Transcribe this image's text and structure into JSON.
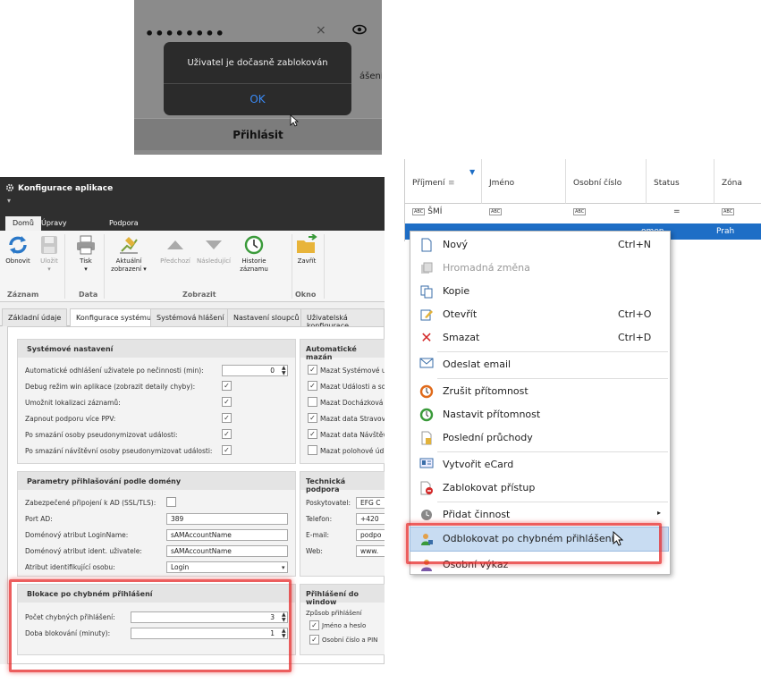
{
  "login": {
    "password_dots": "••••••••",
    "clear_glyph": "×",
    "behind_text": "ášení",
    "login_button": "Přihlásit",
    "alert_message": "Uživatel je dočasně zablokován",
    "alert_ok": "OK"
  },
  "config": {
    "window_title": "Konfigurace aplikace",
    "ribbon_tabs": [
      "Domů",
      "Úpravy",
      "Podpora"
    ],
    "buttons": {
      "refresh": "Obnovit",
      "save": "Uložit",
      "print": "Tisk",
      "current_view": "Aktuální zobrazení ▾",
      "previous": "Předchozí",
      "next": "Následující",
      "history": "Historie záznamu",
      "close": "Zavřít"
    },
    "groups": {
      "record": "Záznam",
      "data": "Data",
      "display": "Zobrazit",
      "window": "Okno"
    },
    "page_tabs": [
      "Základní údaje",
      "Konfigurace systému",
      "Systémová hlášení",
      "Nastavení sloupců",
      "Uživatelská konfigurace"
    ],
    "system_settings": {
      "title": "Systémové nastavení",
      "rows": [
        {
          "label": "Automatické odhlášení uživatele po nečinnosti (min):",
          "value": "0"
        },
        {
          "label": "Debug režim win aplikace (zobrazit detaily chyby):",
          "value": "✓"
        },
        {
          "label": "Umožnit lokalizaci záznamů:",
          "value": "✓"
        },
        {
          "label": "Zapnout podporu více PPV:",
          "value": "✓"
        },
        {
          "label": "Po smazání osoby pseudonymizovat události:",
          "value": "✓"
        },
        {
          "label": "Po smazání návštěvní osoby pseudonymizovat události:",
          "value": "✓"
        }
      ]
    },
    "auto_delete": {
      "title": "Automatické mazán",
      "rows": [
        {
          "label": "Mazat Systémové u",
          "value": "✓"
        },
        {
          "label": "Mazat Události a so",
          "value": "✓"
        },
        {
          "label": "Mazat Docházková",
          "value": ""
        },
        {
          "label": "Mazat data Stravov",
          "value": "✓"
        },
        {
          "label": "Mazat data Návštěv",
          "value": "✓"
        },
        {
          "label": "Mazat polohové úd",
          "value": ""
        }
      ]
    },
    "domain_login": {
      "title": "Parametry přihlašování podle domény",
      "rows": [
        {
          "label": "Zabezpečené připojení k AD (SSL/TLS):",
          "value": ""
        },
        {
          "label": "Port AD:",
          "value": "389"
        },
        {
          "label": "Doménový atribut LoginName:",
          "value": "sAMAccountName"
        },
        {
          "label": "Doménový atribut ident. uživatele:",
          "value": "sAMAccountName"
        },
        {
          "label": "Atribut identifikující osobu:",
          "value": "Login"
        }
      ]
    },
    "tech_support": {
      "title": "Technická podpora",
      "rows": [
        {
          "label": "Poskytovatel:",
          "value": "EFG C"
        },
        {
          "label": "Telefon:",
          "value": "+420"
        },
        {
          "label": "E-mail:",
          "value": "podpo"
        },
        {
          "label": "Web:",
          "value": "www."
        }
      ]
    },
    "lockout": {
      "title": "Blokace po chybném přihlášení",
      "rows": [
        {
          "label": "Počet chybných přihlášení:",
          "value": "3"
        },
        {
          "label": "Doba blokování (minuty):",
          "value": "1"
        }
      ]
    },
    "windows_login": {
      "title": "Přihlášení do window",
      "method_label": "Způsob přihlášení",
      "options": [
        {
          "label": "Jméno a heslo",
          "value": "✓"
        },
        {
          "label": "Osobní číslo a PIN",
          "value": "✓"
        }
      ]
    }
  },
  "grid": {
    "columns": [
      "Příjmení",
      "Jméno",
      "Osobní číslo",
      "Status",
      "Zóna"
    ],
    "filter_tag": "ABC",
    "filter_value": "ŠMÍ",
    "filter_eq": "=",
    "selected_row": {
      "status": "omen",
      "zone": "Prah"
    }
  },
  "menu": {
    "items": [
      {
        "label": "Nový",
        "shortcut": "Ctrl+N",
        "icon": "new-page-icon"
      },
      {
        "label": "Hromadná změna",
        "shortcut": "",
        "icon": "bulk-edit-icon"
      },
      {
        "label": "Kopie",
        "shortcut": "",
        "icon": "copy-icon"
      },
      {
        "label": "Otevřít",
        "shortcut": "Ctrl+O",
        "icon": "edit-icon"
      },
      {
        "label": "Smazat",
        "shortcut": "Ctrl+D",
        "icon": "delete-icon"
      },
      {
        "label": "Odeslat email",
        "shortcut": "",
        "icon": "email-icon"
      },
      {
        "label": "Zrušit přítomnost",
        "shortcut": "",
        "icon": "cancel-presence-icon"
      },
      {
        "label": "Nastavit přítomnost",
        "shortcut": "",
        "icon": "set-presence-icon"
      },
      {
        "label": "Poslední průchody",
        "shortcut": "",
        "icon": "passages-icon"
      },
      {
        "label": "Vytvořit eCard",
        "shortcut": "",
        "icon": "ecard-icon"
      },
      {
        "label": "Zablokovat přístup",
        "shortcut": "",
        "icon": "block-access-icon"
      },
      {
        "label": "Přidat činnost",
        "shortcut": "▸",
        "icon": "add-activity-icon"
      },
      {
        "label": "Odblokovat po chybném přihlášení",
        "shortcut": "",
        "icon": "unlock-user-icon"
      },
      {
        "label": "Osobní výkaz",
        "shortcut": "",
        "icon": "personal-report-icon"
      }
    ]
  },
  "colors": {
    "accent_red": "#e62828",
    "selection_blue": "#1e6ec6",
    "ok_blue": "#3a8af5"
  }
}
